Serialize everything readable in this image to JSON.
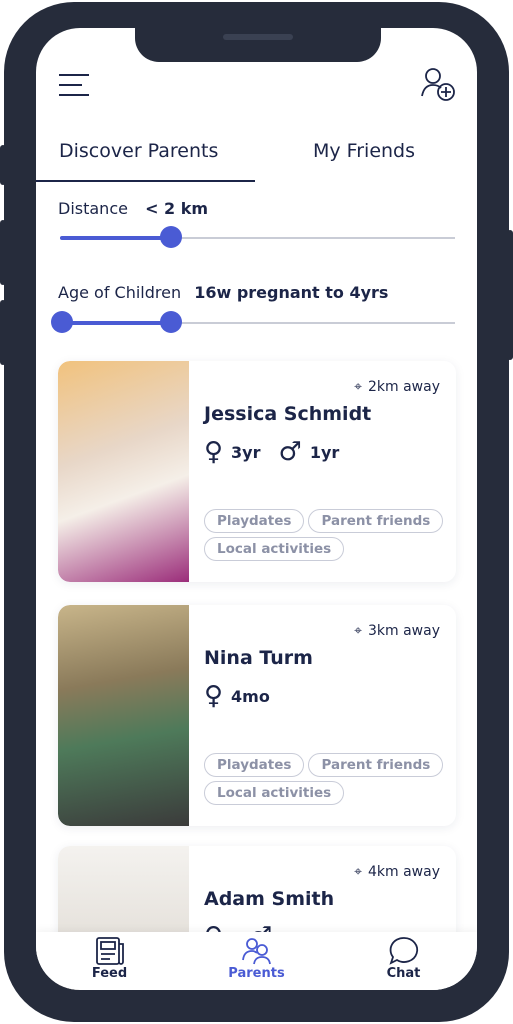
{
  "tabs": [
    {
      "label": "Discover Parents",
      "active": true
    },
    {
      "label": "My Friends",
      "active": false
    }
  ],
  "filters": {
    "distance_label": "Distance",
    "distance_value": "< 2 km",
    "distance_fraction": 0.28,
    "age_label": "Age of Children",
    "age_value": "16w pregnant to 4yrs",
    "age_range_fraction": [
      0,
      0.28
    ]
  },
  "accent": "#4a5bd4",
  "cards": [
    {
      "distance": "2km away",
      "name": "Jessica Schmidt",
      "kids": [
        {
          "gender": "female",
          "age": "3yr"
        },
        {
          "gender": "male",
          "age": "1yr"
        }
      ],
      "tags": [
        "Playdates",
        "Parent friends",
        "Local activities"
      ]
    },
    {
      "distance": "3km away",
      "name": "Nina Turm",
      "kids": [
        {
          "gender": "female",
          "age": "4mo"
        }
      ],
      "tags": [
        "Playdates",
        "Parent friends",
        "Local activities"
      ]
    },
    {
      "distance": "4km away",
      "name": "Adam Smith",
      "kids": [
        {
          "gender": "female",
          "age": ""
        },
        {
          "gender": "male",
          "age": ""
        }
      ],
      "tags": []
    }
  ],
  "nav": [
    {
      "label": "Feed",
      "icon": "newspaper-icon"
    },
    {
      "label": "Parents",
      "icon": "people-icon",
      "active": true
    },
    {
      "label": "Chat",
      "icon": "chat-bubble-icon"
    }
  ]
}
